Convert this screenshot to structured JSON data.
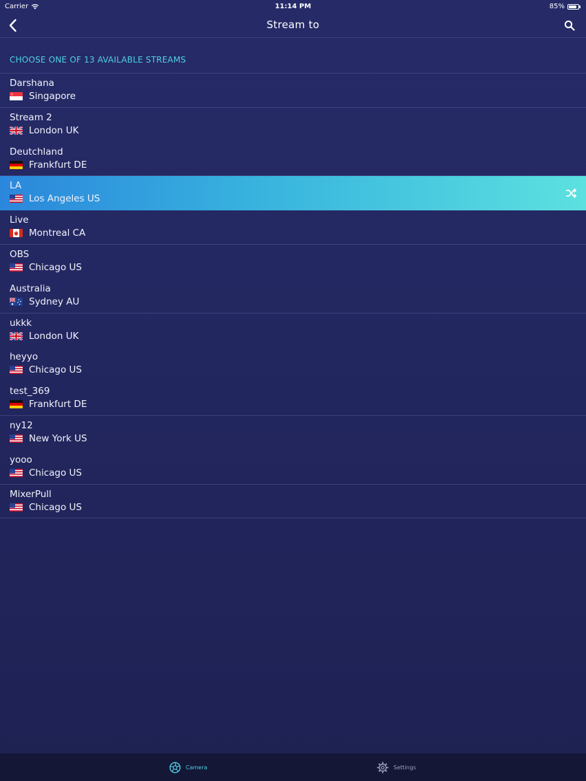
{
  "status_bar": {
    "carrier": "Carrier",
    "time": "11:14 PM",
    "battery_text": "85%",
    "battery_level": 0.85,
    "wifi_icon": "wifi-icon",
    "battery_icon": "battery-icon"
  },
  "nav": {
    "title": "Stream to",
    "back_icon": "chevron-left-icon",
    "search_icon": "search-icon"
  },
  "section": {
    "header": "CHOOSE ONE OF 13 AVAILABLE STREAMS"
  },
  "streams": [
    {
      "name": "Darshana",
      "location": "Singapore",
      "flag": "sg"
    },
    {
      "name": "Stream 2",
      "location": "London UK",
      "flag": "uk"
    },
    {
      "name": "Deutchland",
      "location": "Frankfurt DE",
      "flag": "de"
    },
    {
      "name": "LA",
      "location": "Los Angeles US",
      "flag": "us",
      "selected": true
    },
    {
      "name": "Live",
      "location": "Montreal CA",
      "flag": "ca"
    },
    {
      "name": "OBS",
      "location": "Chicago US",
      "flag": "us"
    },
    {
      "name": "Australia",
      "location": "Sydney AU",
      "flag": "au"
    },
    {
      "name": "ukkk",
      "location": "London UK",
      "flag": "uk"
    },
    {
      "name": "heyyo",
      "location": "Chicago US",
      "flag": "us"
    },
    {
      "name": "test_369",
      "location": "Frankfurt DE",
      "flag": "de"
    },
    {
      "name": "ny12",
      "location": "New York US",
      "flag": "us"
    },
    {
      "name": "yooo",
      "location": "Chicago US",
      "flag": "us"
    },
    {
      "name": "MixerPull",
      "location": "Chicago US",
      "flag": "us"
    }
  ],
  "selected_icon": "shuffle-icon",
  "tab_bar": {
    "items": [
      {
        "label": "Camera",
        "icon": "camera-icon",
        "active": true
      },
      {
        "label": "Settings",
        "icon": "gear-icon",
        "active": false
      }
    ]
  },
  "colors": {
    "background": "#242966",
    "accent": "#4fd0e2",
    "selected_start": "#2b87dc",
    "selected_end": "#5ce1e0",
    "tab_bar": "#141736"
  }
}
